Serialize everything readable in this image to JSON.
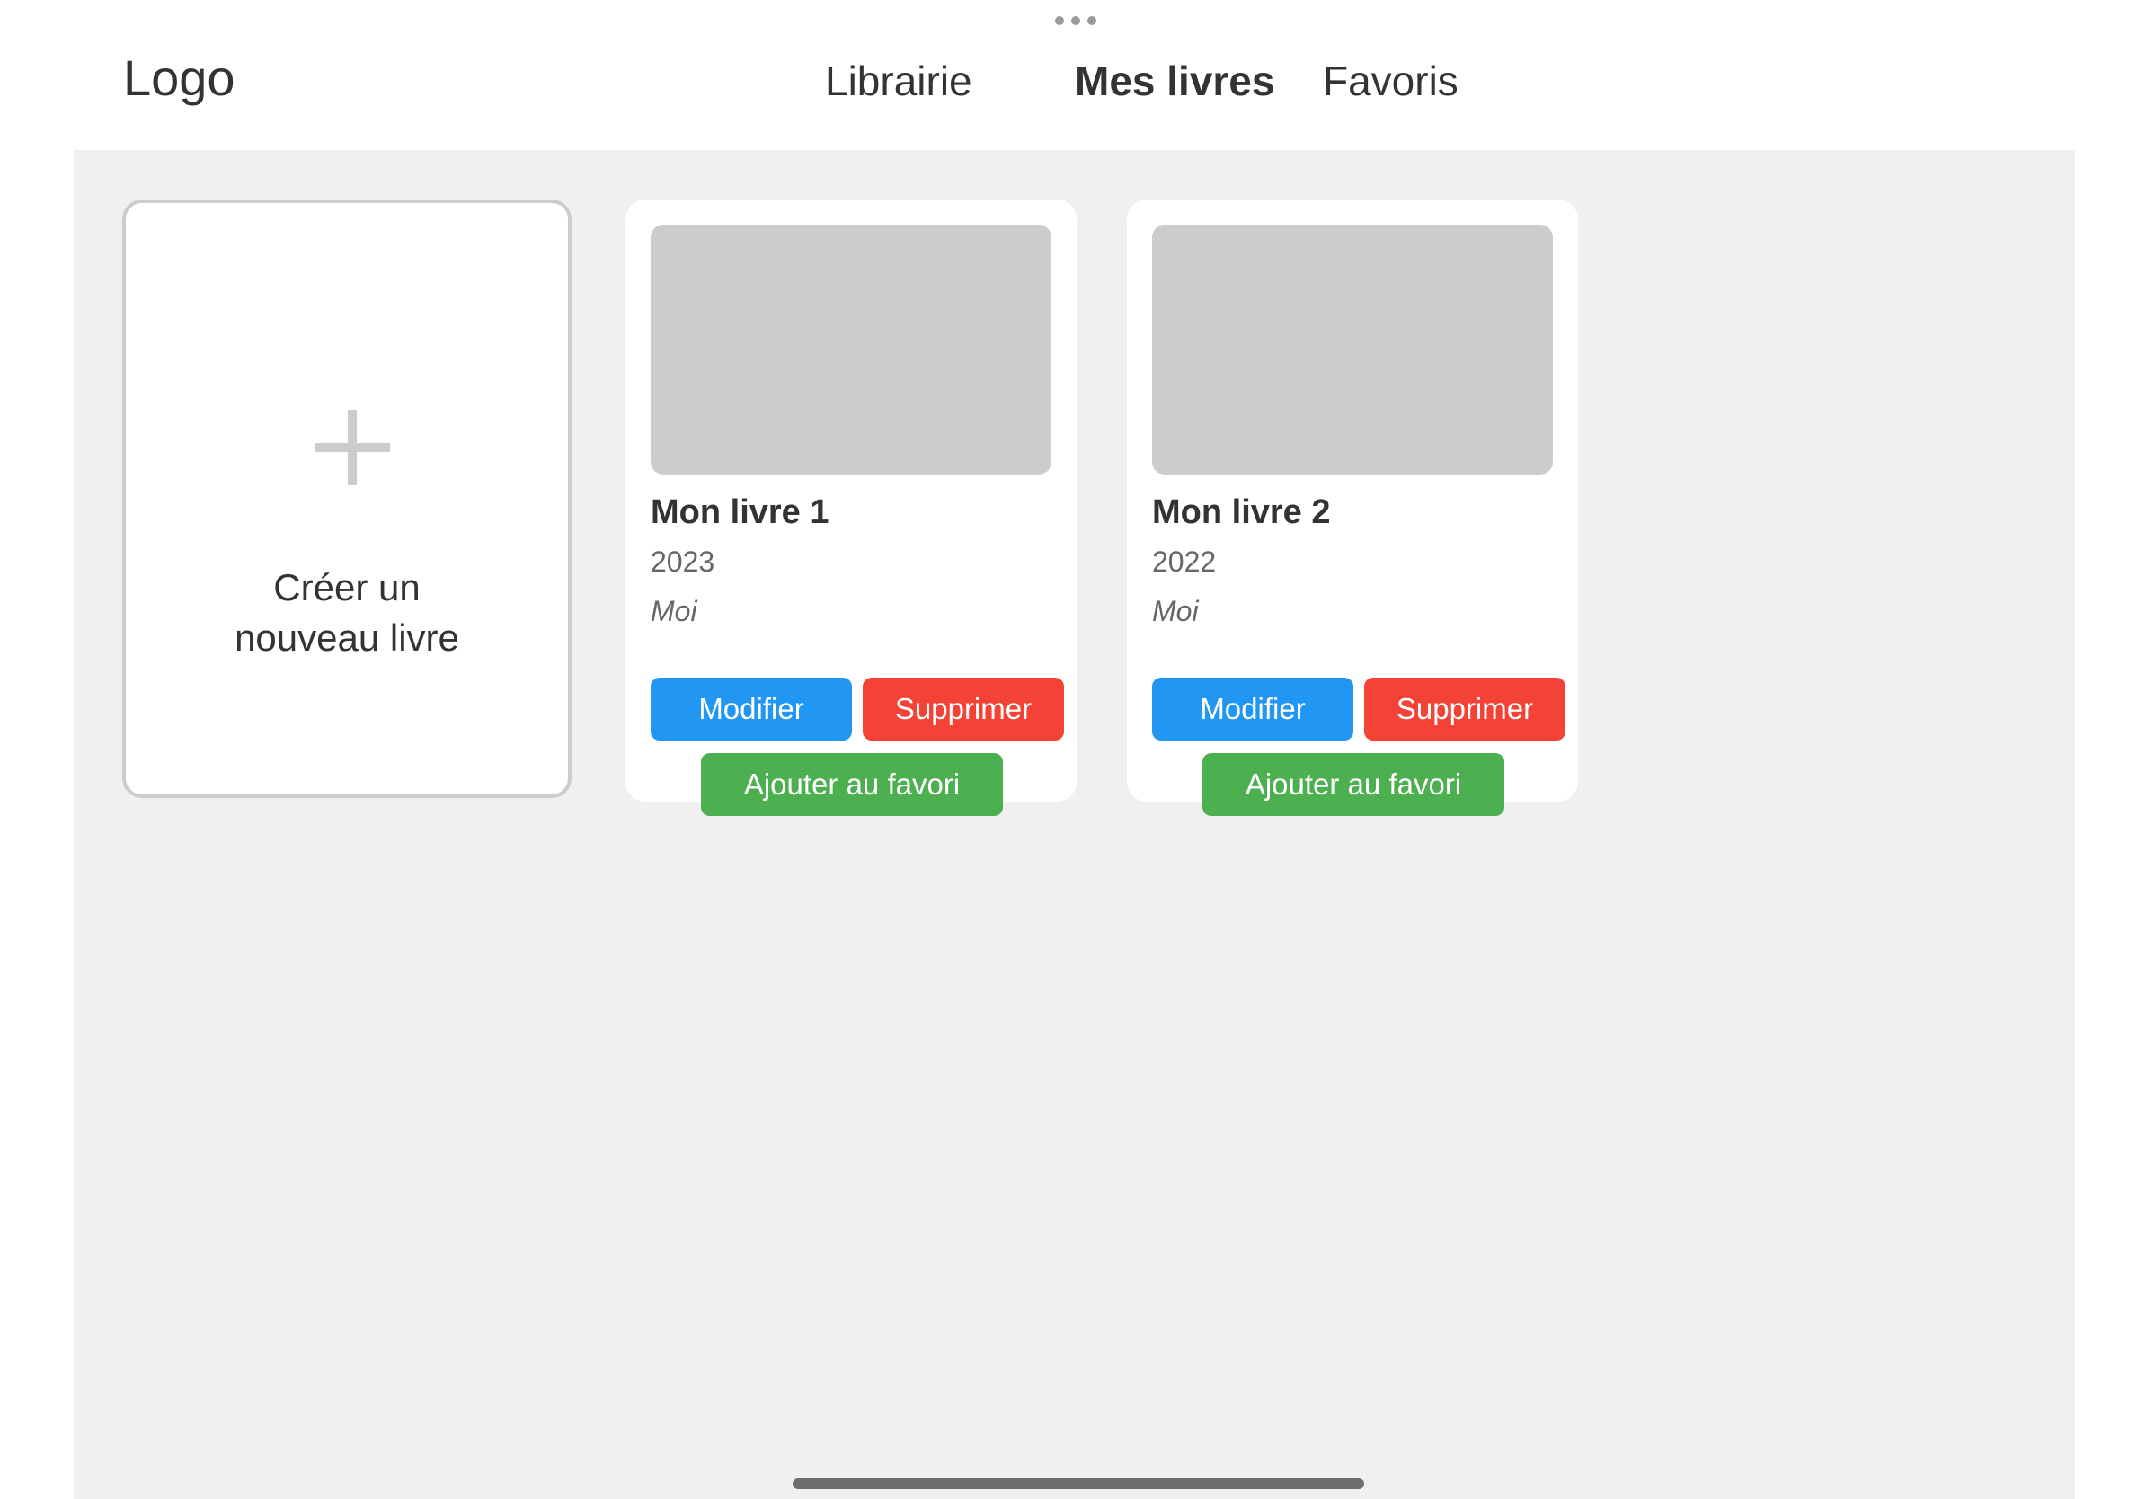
{
  "header": {
    "logo": "Logo",
    "nav": [
      {
        "label": "Librairie",
        "active": false
      },
      {
        "label": "Mes livres",
        "active": true
      },
      {
        "label": "Favoris",
        "active": false
      }
    ]
  },
  "create_card": {
    "icon": "plus-icon",
    "label_line1": "Créer un",
    "label_line2": "nouveau livre"
  },
  "books": [
    {
      "title": "Mon livre 1",
      "year": "2023",
      "author": "Moi",
      "modify_label": "Modifier",
      "delete_label": "Supprimer",
      "favorite_label": "Ajouter au favori"
    },
    {
      "title": "Mon livre 2",
      "year": "2022",
      "author": "Moi",
      "modify_label": "Modifier",
      "delete_label": "Supprimer",
      "favorite_label": "Ajouter au favori"
    }
  ],
  "colors": {
    "modify": "#2196f3",
    "delete": "#f44336",
    "favorite": "#4caf50",
    "cover_placeholder": "#cccccc",
    "background": "#f0f0f0"
  }
}
